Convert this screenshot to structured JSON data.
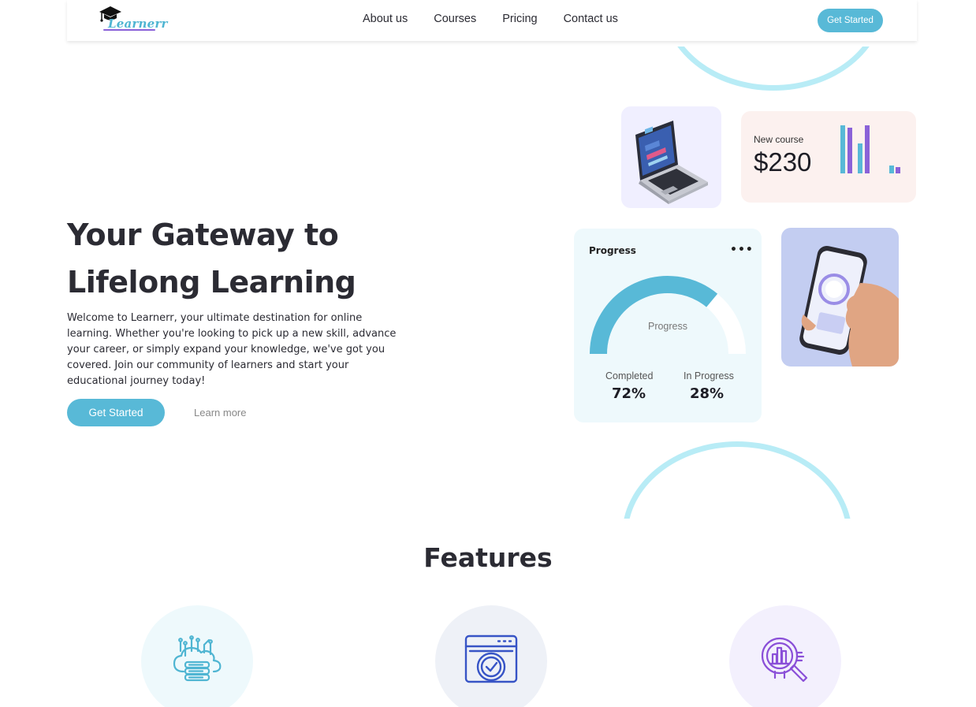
{
  "brand": {
    "logo_text": "Learnerr"
  },
  "nav": {
    "links": [
      "About us",
      "Courses",
      "Pricing",
      "Contact us"
    ],
    "cta_label": "Get Started"
  },
  "hero": {
    "title_line1": "Your Gateway to",
    "title_line2": "Lifelong Learning",
    "description": "Welcome to Learnerr, your ultimate destination for online learning. Whether you're looking to pick up a new skill, advance your career, or simply expand your knowledge, we've got you covered. Join our community of learners and start your educational journey today!",
    "primary_button": "Get Started",
    "secondary_button": "Learn more"
  },
  "course_card": {
    "label": "New course",
    "price": "$230",
    "bars": [
      {
        "level": 0.95,
        "color": "#58b9d7"
      },
      {
        "level": 0.9,
        "color": "#8a62d8"
      },
      {
        "level": 0.6,
        "color": "#58b9d7"
      },
      {
        "level": 0.95,
        "color": "#8a62d8"
      },
      {
        "level": 0.15,
        "color": "#58b9d7"
      },
      {
        "level": 0.12,
        "color": "#8a62d8"
      }
    ]
  },
  "progress_card": {
    "title": "Progress",
    "menu_icon": "more-dots-icon",
    "gauge_label": "Progress",
    "completed_label": "Completed",
    "completed_value": "72%",
    "completed_fraction": 0.72,
    "in_progress_label": "In Progress",
    "in_progress_value": "28%",
    "colors": {
      "filled": "#58b9d7",
      "track": "#ffffff"
    }
  },
  "features": {
    "title": "Features",
    "items": [
      {
        "icon": "cloud-network-icon"
      },
      {
        "icon": "browser-check-icon"
      },
      {
        "icon": "analytics-search-icon"
      }
    ]
  },
  "colors": {
    "accent": "#58b9d7",
    "purple": "#8a62d8",
    "arc": "#b8ecf6",
    "text": "#2b2b33"
  }
}
